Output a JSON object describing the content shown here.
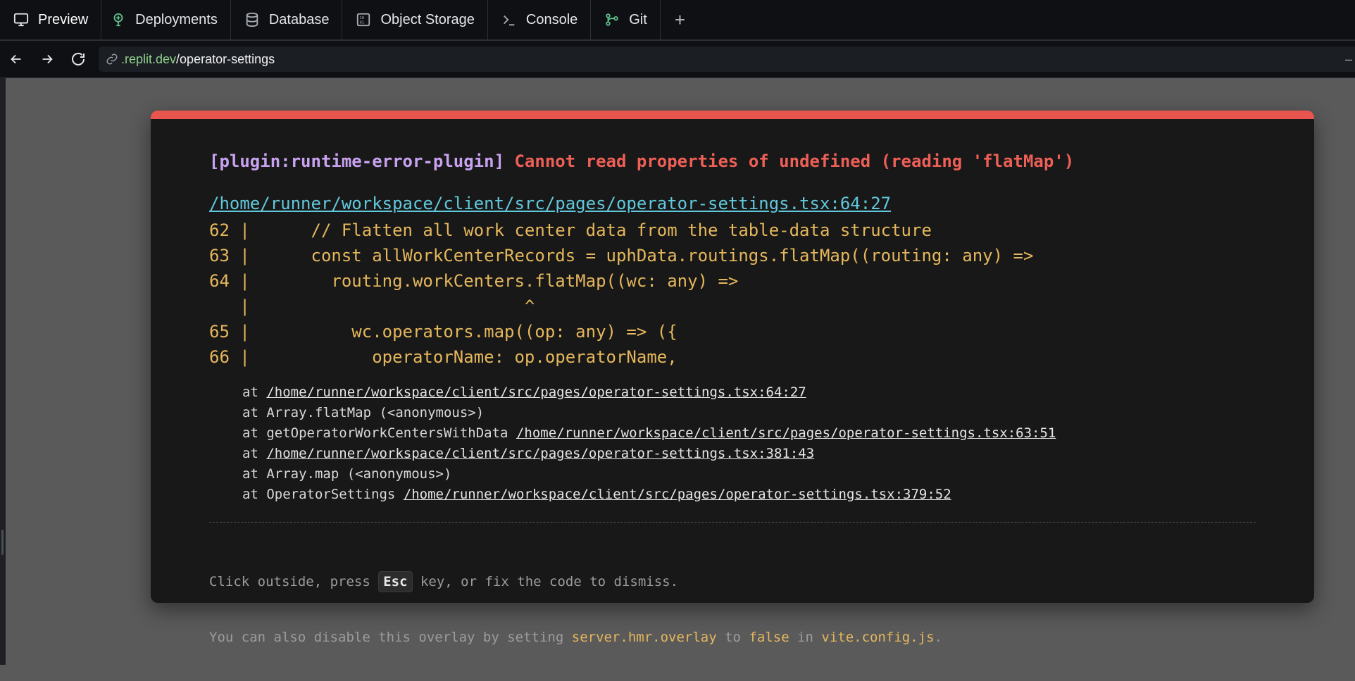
{
  "tabs": [
    {
      "label": "Preview",
      "icon": "monitor-icon"
    },
    {
      "label": "Deployments",
      "icon": "deploy-icon"
    },
    {
      "label": "Database",
      "icon": "database-icon"
    },
    {
      "label": "Object Storage",
      "icon": "object-storage-icon"
    },
    {
      "label": "Console",
      "icon": "console-icon"
    },
    {
      "label": "Git",
      "icon": "git-icon"
    }
  ],
  "new_tab_label": "+",
  "address": {
    "host": ".replit.dev",
    "path": "/operator-settings",
    "trailing": "–"
  },
  "error": {
    "plugin": "[plugin:runtime-error-plugin]",
    "message": "Cannot read properties of undefined (reading 'flatMap')",
    "file": "/home/runner/workspace/client/src/pages/operator-settings.tsx:64:27",
    "frame": [
      "62 |      // Flatten all work center data from the table-data structure",
      "63 |      const allWorkCenterRecords = uphData.routings.flatMap((routing: any) =>",
      "64 |        routing.workCenters.flatMap((wc: any) =>",
      "   |                           ^",
      "65 |          wc.operators.map((op: any) => ({",
      "66 |            operatorName: op.operatorName,"
    ],
    "stack": [
      {
        "prefix": "at ",
        "fn": "",
        "link": "/home/runner/workspace/client/src/pages/operator-settings.tsx:64:27"
      },
      {
        "prefix": "at ",
        "fn": "Array.flatMap (<anonymous>)",
        "link": ""
      },
      {
        "prefix": "at ",
        "fn": "getOperatorWorkCentersWithData ",
        "link": "/home/runner/workspace/client/src/pages/operator-settings.tsx:63:51"
      },
      {
        "prefix": "at ",
        "fn": "",
        "link": "/home/runner/workspace/client/src/pages/operator-settings.tsx:381:43"
      },
      {
        "prefix": "at ",
        "fn": "Array.map (<anonymous>)",
        "link": ""
      },
      {
        "prefix": "at ",
        "fn": "OperatorSettings ",
        "link": "/home/runner/workspace/client/src/pages/operator-settings.tsx:379:52"
      }
    ],
    "tip1_a": "Click outside, press ",
    "tip1_key": "Esc",
    "tip1_b": " key, or fix the code to dismiss.",
    "tip2_a": "You can also disable this overlay by setting ",
    "tip2_code1": "server.hmr.overlay",
    "tip2_b": " to ",
    "tip2_code2": "false",
    "tip2_c": " in ",
    "tip2_code3": "vite.config.js",
    "tip2_d": "."
  },
  "colors": {
    "accent_red": "#e8544e",
    "plugin_purple": "#c8a2f0",
    "link_cyan": "#61c8dc",
    "code_yellow": "#e5b75c"
  }
}
